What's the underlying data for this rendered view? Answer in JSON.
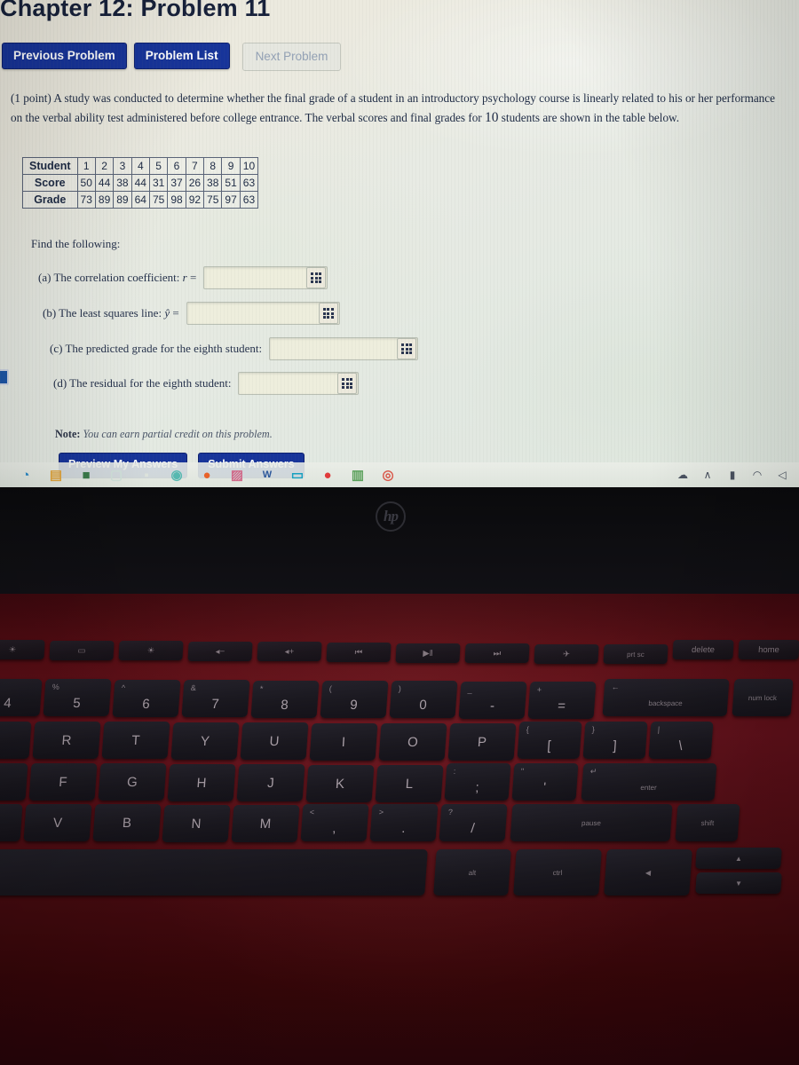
{
  "page": {
    "title": "Chapter 12: Problem 11"
  },
  "nav": {
    "previous": "Previous Problem",
    "list": "Problem List",
    "next": "Next Problem"
  },
  "problem": {
    "points": "(1 point)",
    "text_part1": "A study was conducted to determine whether the final grade of a student in an introductory psychology course is linearly related to his or her performance on the verbal ability test administered before college entrance. The verbal scores and final grades for ",
    "count": "10",
    "text_part2": " students are shown in the table below."
  },
  "table": {
    "row_headers": [
      "Student",
      "Score",
      "Grade"
    ],
    "student": [
      "1",
      "2",
      "3",
      "4",
      "5",
      "6",
      "7",
      "8",
      "9",
      "10"
    ],
    "score": [
      "50",
      "44",
      "38",
      "44",
      "31",
      "37",
      "26",
      "38",
      "51",
      "63"
    ],
    "grade": [
      "73",
      "89",
      "89",
      "64",
      "75",
      "98",
      "92",
      "75",
      "97",
      "63"
    ]
  },
  "questions": {
    "heading": "Find the following:",
    "items": [
      {
        "label": "(a) The correlation coefficient:",
        "symbol": "r",
        "equals": "=",
        "value": "",
        "icon": "grid-keypad-icon"
      },
      {
        "label": "(b) The least squares line:",
        "symbol": "ŷ",
        "equals": "=",
        "value": "",
        "icon": "grid-keypad-icon"
      },
      {
        "label": "(c) The predicted grade for the eighth student:",
        "symbol": "",
        "equals": "",
        "value": "",
        "icon": "grid-keypad-icon"
      },
      {
        "label": "(d) The residual for the eighth student:",
        "symbol": "",
        "equals": "",
        "value": "",
        "icon": "grid-keypad-icon"
      }
    ]
  },
  "note": {
    "prefix": "Note:",
    "text": "You can earn partial credit on this problem."
  },
  "actions": {
    "preview": "Preview My Answers",
    "submit": "Submit Answers"
  },
  "taskbar": {
    "icons": [
      {
        "name": "edge-icon",
        "glyph": "◔",
        "color": "#2b8ac8"
      },
      {
        "name": "file-explorer-icon",
        "glyph": "▤",
        "color": "#e0a33a"
      },
      {
        "name": "store-bag-icon",
        "glyph": "■",
        "color": "#3a7a4a"
      },
      {
        "name": "app-icon-4",
        "glyph": "▢",
        "color": "#cfe0d8"
      },
      {
        "name": "app-icon-5",
        "glyph": "▪",
        "color": "#dde3dc"
      },
      {
        "name": "teams-icon",
        "glyph": "◉",
        "color": "#56b8b0"
      },
      {
        "name": "firefox-icon",
        "glyph": "●",
        "color": "#e8622a"
      },
      {
        "name": "photos-icon",
        "glyph": "▨",
        "color": "#d06a8a"
      },
      {
        "name": "word-icon",
        "glyph": "W",
        "color": "#2b579a"
      },
      {
        "name": "mail-icon",
        "glyph": "▭",
        "color": "#17a0c0"
      },
      {
        "name": "record-icon",
        "glyph": "●",
        "color": "#e03b3b"
      },
      {
        "name": "excel-icon",
        "glyph": "▥",
        "color": "#5aa05a"
      },
      {
        "name": "chrome-icon",
        "glyph": "◎",
        "color": "#d9584a"
      }
    ],
    "tray": [
      {
        "name": "onedrive-icon",
        "glyph": "☁"
      },
      {
        "name": "show-hidden-icons-chevron",
        "glyph": "∧"
      },
      {
        "name": "battery-icon",
        "glyph": "▮"
      },
      {
        "name": "wifi-icon",
        "glyph": "◠"
      },
      {
        "name": "volume-icon",
        "glyph": "◁"
      }
    ]
  },
  "laptop": {
    "brand": "hp",
    "function_row": [
      {
        "fn": "f3",
        "glyph": "☀"
      },
      {
        "fn": "f4",
        "glyph": "▭"
      },
      {
        "fn": "f5",
        "glyph": "☀"
      },
      {
        "fn": "f6",
        "glyph": "◂−"
      },
      {
        "fn": "f7",
        "glyph": "◂+"
      },
      {
        "fn": "f8",
        "glyph": "⏮"
      },
      {
        "fn": "f9",
        "glyph": "▶‖"
      },
      {
        "fn": "f10",
        "glyph": "⏭"
      },
      {
        "fn": "f11",
        "glyph": "✈"
      },
      {
        "fn": "f12",
        "glyph": "prt sc"
      }
    ],
    "number_row": [
      {
        "sup": "$",
        "main": "4"
      },
      {
        "sup": "%",
        "main": "5"
      },
      {
        "sup": "^",
        "main": "6"
      },
      {
        "sup": "&",
        "main": "7"
      },
      {
        "sup": "*",
        "main": "8"
      },
      {
        "sup": "(",
        "main": "9"
      },
      {
        "sup": ")",
        "main": "0"
      },
      {
        "sup": "_",
        "main": "-"
      },
      {
        "sup": "+",
        "main": "="
      }
    ],
    "top_right_keys": [
      "delete",
      "home"
    ],
    "backspace": "backspace",
    "numlock": "num lock",
    "letter_row1": [
      "R",
      "T",
      "Y",
      "U",
      "I",
      "O",
      "P"
    ],
    "bracket_keys": [
      {
        "sup": "{",
        "main": "["
      },
      {
        "sup": "}",
        "main": "]"
      },
      {
        "sup": "|",
        "main": "\\"
      }
    ],
    "letter_row2": [
      "F",
      "G",
      "H",
      "J",
      "K",
      "L"
    ],
    "punct_row2": [
      {
        "sup": ":",
        "main": ";"
      },
      {
        "sup": "\"",
        "main": "'"
      }
    ],
    "enter": "enter",
    "letter_row3": [
      "V",
      "B",
      "N",
      "M"
    ],
    "punct_row3": [
      {
        "sup": "<",
        "main": ","
      },
      {
        "sup": ">",
        "main": "."
      },
      {
        "sup": "?",
        "main": "/"
      }
    ],
    "pause": "pause",
    "shift": "shift",
    "bottom_row": [
      "alt",
      "ctrl"
    ]
  },
  "colors": {
    "accent_blue": "#17349a",
    "screen_bg": "#e5e9de",
    "deck_red": "#5a0d14",
    "key_dark": "#1a181f"
  }
}
